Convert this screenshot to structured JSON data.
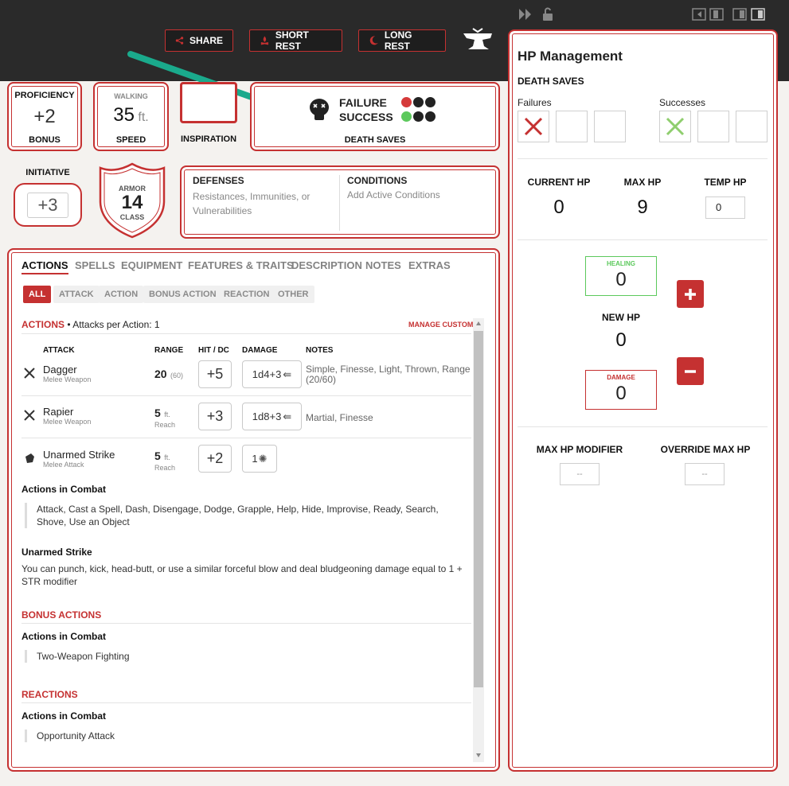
{
  "toolbar": {
    "share": "SHARE",
    "short_rest": "SHORT REST",
    "long_rest": "LONG REST"
  },
  "stats": {
    "proficiency_label": "PROFICIENCY",
    "proficiency_value": "+2",
    "proficiency_sub": "BONUS",
    "walking_label": "WALKING",
    "speed_value": "35",
    "speed_unit": "ft.",
    "speed_sub": "SPEED",
    "inspiration_label": "INSPIRATION",
    "initiative_label": "INITIATIVE",
    "initiative_value": "+3",
    "armor_label": "ARMOR",
    "armor_value": "14",
    "armor_sub": "CLASS"
  },
  "death_saves": {
    "failure": "FAILURE",
    "success": "SUCCESS",
    "title": "DEATH SAVES"
  },
  "defenses": {
    "title": "DEFENSES",
    "text": "Resistances, Immunities, or Vulnerabilities"
  },
  "conditions": {
    "title": "CONDITIONS",
    "text": "Add Active Conditions"
  },
  "tabs": [
    "ACTIONS",
    "SPELLS",
    "EQUIPMENT",
    "FEATURES & TRAITS",
    "DESCRIPTION",
    "NOTES",
    "EXTRAS"
  ],
  "filters": [
    "ALL",
    "ATTACK",
    "ACTION",
    "BONUS ACTION",
    "REACTION",
    "OTHER"
  ],
  "actions": {
    "title": "ACTIONS",
    "per_action": "• Attacks per Action: 1",
    "manage": "MANAGE CUSTOM",
    "columns": [
      "ATTACK",
      "RANGE",
      "HIT / DC",
      "DAMAGE",
      "NOTES"
    ],
    "attacks": [
      {
        "name": "Dagger",
        "sub": "Melee Weapon",
        "range": "20",
        "range_sub": "(60)",
        "hit": "+5",
        "damage": "1d4+3",
        "notes": "Simple, Finesse, Light, Thrown, Range (20/60)"
      },
      {
        "name": "Rapier",
        "sub": "Melee Weapon",
        "range": "5",
        "range_unit": "ft.",
        "range_sub": "Reach",
        "hit": "+3",
        "damage": "1d8+3",
        "notes": "Martial, Finesse"
      },
      {
        "name": "Unarmed Strike",
        "sub": "Melee Attack",
        "range": "5",
        "range_unit": "ft.",
        "range_sub": "Reach",
        "hit": "+2",
        "damage": "1"
      }
    ],
    "combat_title": "Actions in Combat",
    "combat_text": "Attack, Cast a Spell, Dash, Disengage, Dodge, Grapple, Help, Hide, Improvise, Ready, Search, Shove, Use an Object",
    "unarmed_title": "Unarmed Strike",
    "unarmed_text": "You can punch, kick, head-butt, or use a similar forceful blow and deal bludgeoning damage equal to 1 + STR modifier"
  },
  "bonus_actions": {
    "title": "BONUS ACTIONS",
    "combat_title": "Actions in Combat",
    "item": "Two-Weapon Fighting"
  },
  "reactions": {
    "title": "REACTIONS",
    "combat_title": "Actions in Combat",
    "item": "Opportunity Attack"
  },
  "hp": {
    "title": "HP Management",
    "death_saves": "DEATH SAVES",
    "failures": "Failures",
    "successes": "Successes",
    "current_label": "CURRENT HP",
    "current_value": "0",
    "max_label": "MAX HP",
    "max_value": "9",
    "temp_label": "TEMP HP",
    "temp_value": "0",
    "healing_label": "HEALING",
    "healing_value": "0",
    "new_label": "NEW HP",
    "new_value": "0",
    "damage_label": "DAMAGE",
    "damage_value": "0",
    "max_mod_label": "MAX HP MODIFIER",
    "max_mod_value": "--",
    "override_label": "OVERRIDE MAX HP",
    "override_value": "--"
  },
  "colors": {
    "accent": "#c53131",
    "success": "#5cc95c",
    "arrow": "#1aaa8c"
  }
}
